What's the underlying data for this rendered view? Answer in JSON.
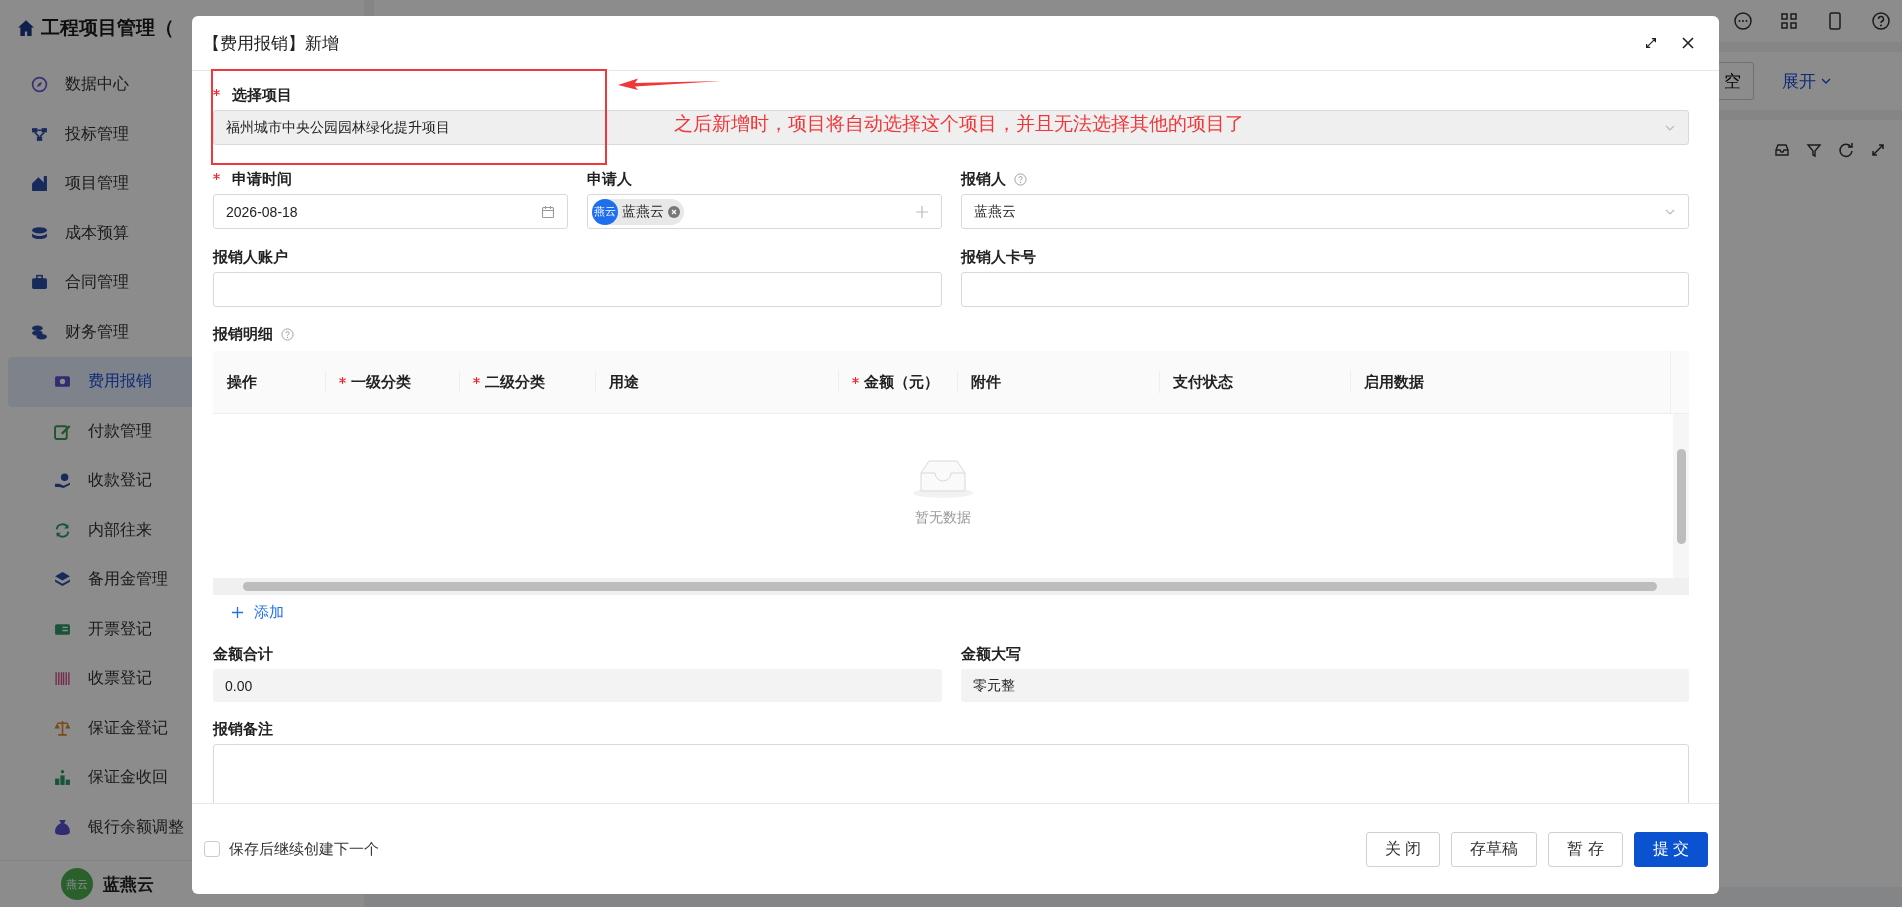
{
  "app": {
    "title": "工程项目管理（"
  },
  "sidebar": {
    "items": [
      {
        "label": "数据中心",
        "selected": false
      },
      {
        "label": "投标管理",
        "selected": false
      },
      {
        "label": "项目管理",
        "selected": false
      },
      {
        "label": "成本预算",
        "selected": false
      },
      {
        "label": "合同管理",
        "selected": false
      },
      {
        "label": "财务管理",
        "selected": false,
        "expanded": true,
        "children": [
          {
            "label": "费用报销",
            "selected": true
          },
          {
            "label": "付款管理",
            "selected": false
          },
          {
            "label": "收款登记",
            "selected": false
          },
          {
            "label": "内部往来",
            "selected": false
          },
          {
            "label": "备用金管理",
            "selected": false
          },
          {
            "label": "开票登记",
            "selected": false
          },
          {
            "label": "收票登记",
            "selected": false
          },
          {
            "label": "保证金登记",
            "selected": false
          },
          {
            "label": "保证金收回",
            "selected": false
          },
          {
            "label": "银行余额调整",
            "selected": false
          }
        ]
      }
    ],
    "user": {
      "avatar": "燕云",
      "name": "蓝燕云"
    }
  },
  "page": {
    "clear_button": "空",
    "expand_link": "展开"
  },
  "dialog": {
    "title": "【费用报销】新增",
    "project": {
      "label": "选择项目",
      "required": true,
      "value": "福州城市中央公园园林绿化提升项目",
      "disabled": true
    },
    "apply_date": {
      "label": "申请时间",
      "required": true,
      "value": "2026-08-18"
    },
    "applicant": {
      "label": "申请人",
      "avatar": "燕云",
      "value": "蓝燕云"
    },
    "reimburser": {
      "label": "报销人",
      "value": "蓝燕云"
    },
    "account": {
      "label": "报销人账户"
    },
    "card": {
      "label": "报销人卡号"
    },
    "details": {
      "label": "报销明细",
      "columns": [
        {
          "label": "操作",
          "required": false
        },
        {
          "label": "一级分类",
          "required": true
        },
        {
          "label": "二级分类",
          "required": true
        },
        {
          "label": "用途",
          "required": false
        },
        {
          "label": "金额（元）",
          "required": true
        },
        {
          "label": "附件",
          "required": false
        },
        {
          "label": "支付状态",
          "required": false
        },
        {
          "label": "启用数据",
          "required": false
        }
      ],
      "empty_text": "暂无数据",
      "add_button": "添加"
    },
    "total": {
      "label": "金额合计",
      "value": "0.00",
      "disabled": true
    },
    "total_upper": {
      "label": "金额大写",
      "value": "零元整",
      "disabled": true
    },
    "remark": {
      "label": "报销备注"
    },
    "continue_checkbox": {
      "label": "保存后继续创建下一个",
      "checked": false
    },
    "buttons": [
      {
        "label": "关 闭",
        "kind": "default"
      },
      {
        "label": "存草稿",
        "kind": "default"
      },
      {
        "label": "暂 存",
        "kind": "default"
      },
      {
        "label": "提 交",
        "kind": "primary"
      }
    ]
  },
  "annotation": {
    "text": "之后新增时，项目将自动选择这个项目，并且无法选择其他的项目了"
  }
}
